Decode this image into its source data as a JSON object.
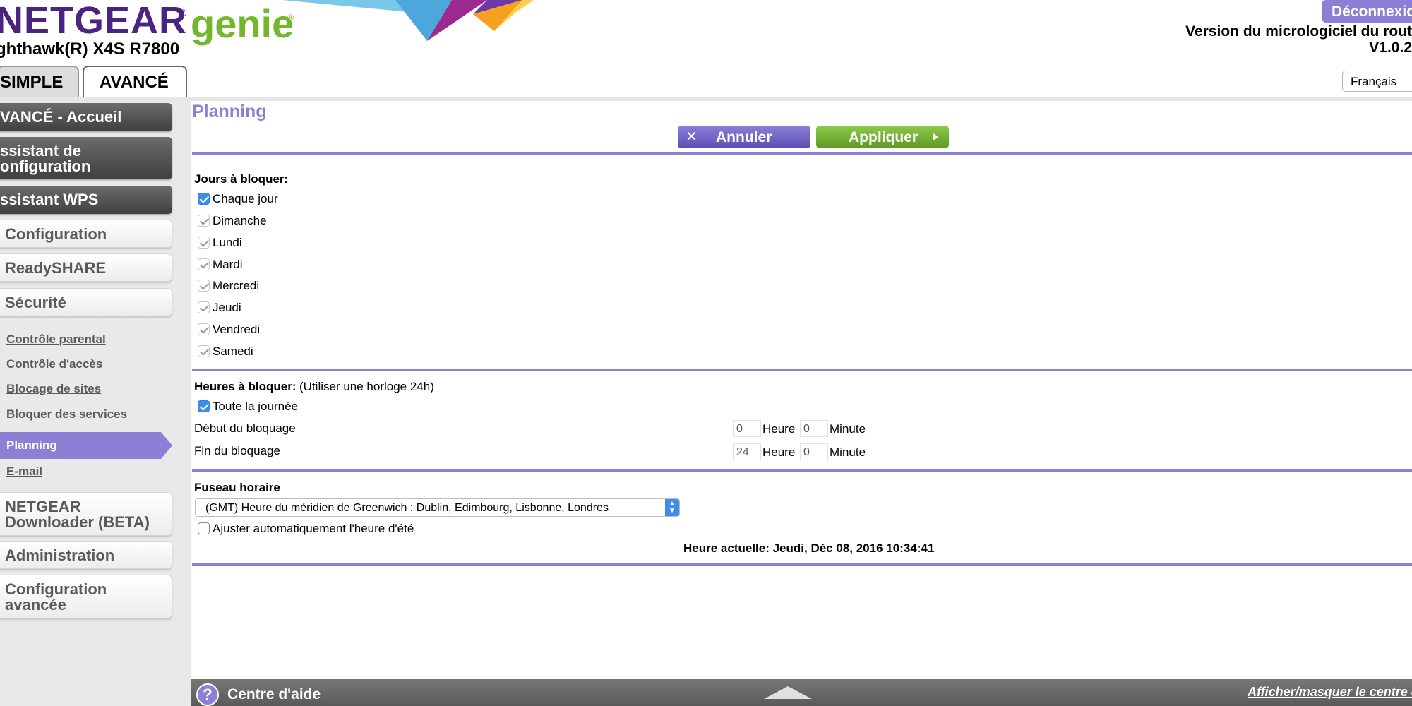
{
  "header": {
    "brand": "NETGEAR",
    "brand_reg": "®",
    "product": "genie",
    "product_reg": "®",
    "model": "ghthawk(R) X4S R7800",
    "logout_label": "Déconnexio",
    "firmware_label": "Version du micrologiciel du rout",
    "firmware_value": "V1.0.2",
    "language": "Français"
  },
  "tabs": {
    "simple": "SIMPLE",
    "advanced": "AVANCÉ"
  },
  "sidebar": {
    "home": "VANCÉ - Accueil",
    "setup_wizard_line1": "ssistant de",
    "setup_wizard_line2": "onfiguration",
    "wps_wizard": "ssistant WPS",
    "configuration": "Configuration",
    "readyshare": "ReadySHARE",
    "security": "Sécurité",
    "security_items": [
      "Contrôle parental",
      "Contrôle d'accès",
      "Blocage de sites",
      "Bloquer des services",
      "Planning",
      "E-mail"
    ],
    "downloader_line1": "NETGEAR",
    "downloader_line2": "Downloader (BETA)",
    "administration": "Administration",
    "advanced_config_line1": "Configuration",
    "advanced_config_line2": "avancée"
  },
  "content": {
    "title": "Planning",
    "cancel_label": "Annuler",
    "apply_label": "Appliquer",
    "days_heading": "Jours à bloquer:",
    "every_day": "Chaque jour",
    "days": [
      "Dimanche",
      "Lundi",
      "Mardi",
      "Mercredi",
      "Jeudi",
      "Vendredi",
      "Samedi"
    ],
    "hours_heading": "Heures à bloquer:",
    "hours_hint": "(Utiliser une horloge 24h)",
    "all_day": "Toute la journée",
    "start_label": "Début du bloquage",
    "end_label": "Fin du bloquage",
    "hour_unit": "Heure",
    "minute_unit": "Minute",
    "start_hour": "0",
    "start_minute": "0",
    "end_hour": "24",
    "end_minute": "0",
    "timezone_heading": "Fuseau horaire",
    "timezone_value": "(GMT) Heure du méridien de Greenwich : Dublin, Edimbourg, Lisbonne, Londres",
    "dst_label": "Ajuster automatiquement l'heure d'été",
    "current_time": "Heure actuelle: Jeudi, Déc 08, 2016 10:34:41"
  },
  "footer": {
    "help_icon": "?",
    "help_label": "Centre d'aide",
    "toggle_help": "Afficher/masquer le centre d'a"
  },
  "colors": {
    "accent": "#8b7fd6",
    "brand_purple": "#4b2482",
    "brand_green": "#74b72e",
    "apply_green": "#6faf30",
    "checkbox_blue": "#3d8ee8"
  }
}
